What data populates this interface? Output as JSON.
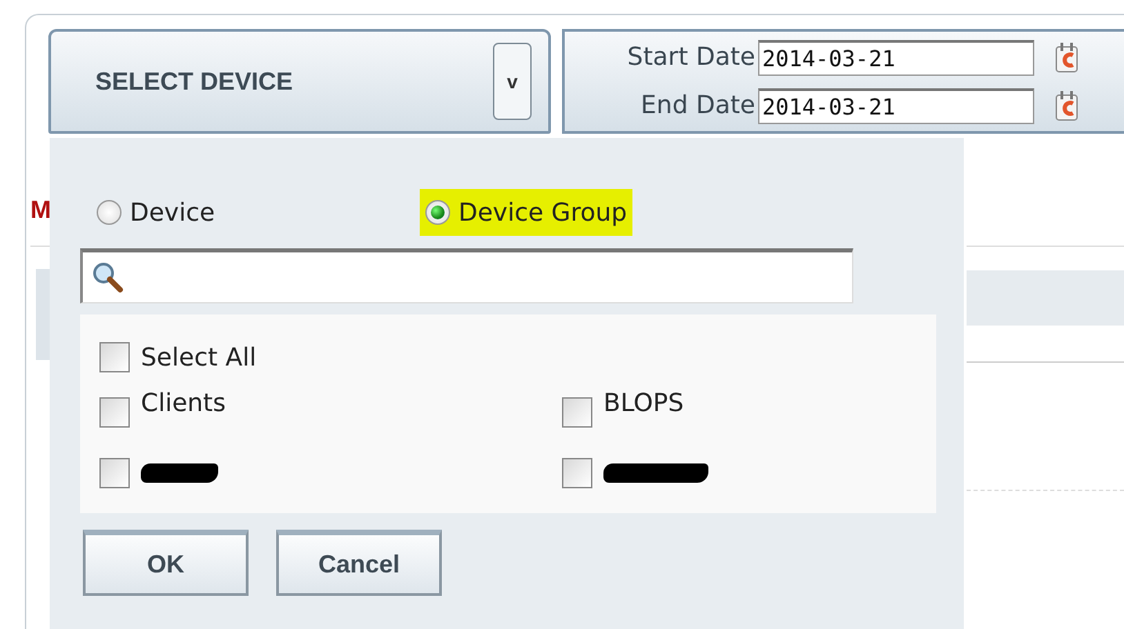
{
  "device_selector": {
    "label": "SELECT DEVICE",
    "caret": "v"
  },
  "dates": [
    {
      "label": "Start Date",
      "value": "2014-03-21"
    },
    {
      "label": "End Date",
      "value": "2014-03-21"
    }
  ],
  "background_fragment": "M",
  "popup": {
    "modes": [
      {
        "label": "Device",
        "selected": false,
        "highlighted": false
      },
      {
        "label": "Device Group",
        "selected": true,
        "highlighted": true
      }
    ],
    "select_all": {
      "label": "Select All",
      "checked": false
    },
    "groups": [
      {
        "kind": "option",
        "label": "Clients",
        "checked": false
      },
      {
        "kind": "option",
        "label": "BLOPS",
        "checked": false
      },
      {
        "kind": "redacted",
        "checked": false
      },
      {
        "kind": "redacted",
        "checked": false
      }
    ],
    "buttons": [
      "OK",
      "Cancel"
    ]
  }
}
